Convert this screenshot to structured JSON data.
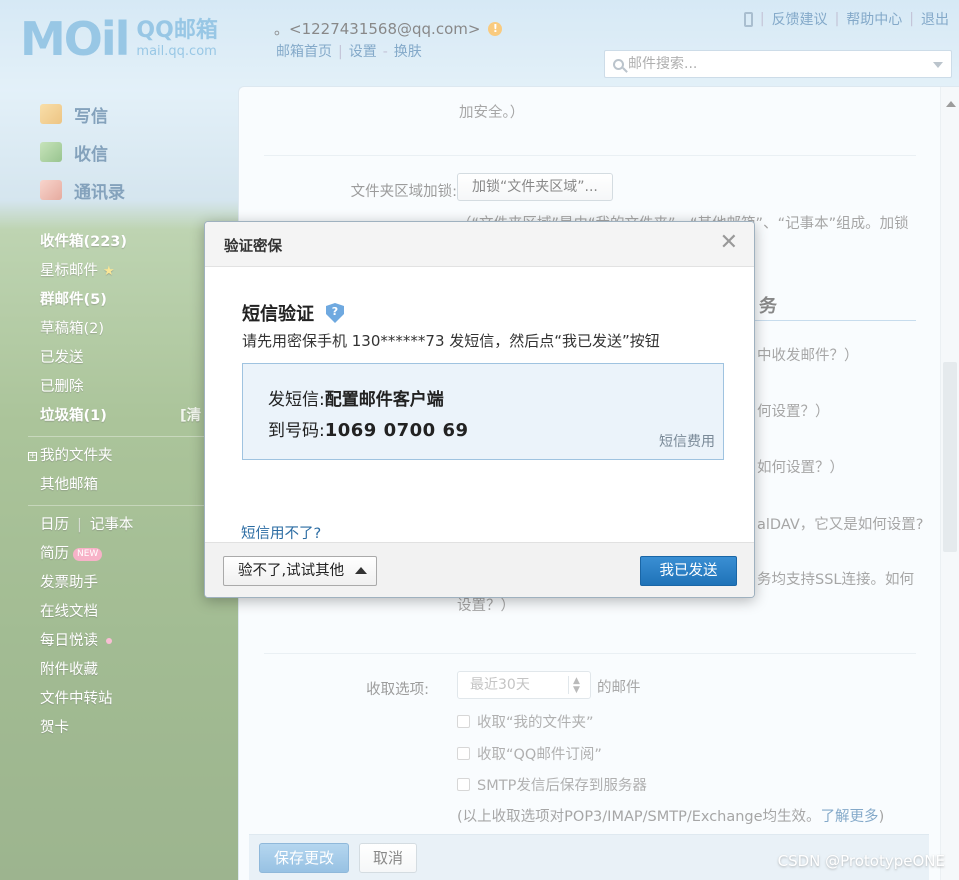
{
  "header": {
    "logo_mark": "MOil",
    "logo_title": "QQ邮箱",
    "logo_sub": "mail.qq.com",
    "account_prefix": "。",
    "account_email": "<1227431568@qq.com>",
    "links": [
      "邮箱首页",
      "设置",
      "换肤"
    ],
    "right_links": [
      "反馈建议",
      "帮助中心",
      "退出"
    ],
    "search_placeholder": "邮件搜索..."
  },
  "sidebar": {
    "actions": [
      "写信",
      "收信",
      "通讯录"
    ],
    "folders": {
      "inbox": "收件箱(223)",
      "starred": "星标邮件",
      "group": "群邮件(5)",
      "drafts": "草稿箱(2)",
      "sent": "已发送",
      "deleted": "已删除",
      "spam": "垃圾箱(1)",
      "spam_clear": "[清",
      "my_folders": "我的文件夹",
      "other_mail": "其他邮箱",
      "calendar": "日历",
      "notes": "记事本",
      "resume": "简历",
      "resume_badge": "NEW",
      "invoice": "发票助手",
      "docs": "在线文档",
      "reading": "每日悦读",
      "attachments": "附件收藏",
      "transfer": "文件中转站",
      "cards": "贺卡"
    }
  },
  "main": {
    "top_text": "加安全。）",
    "folder_lock_label": "文件夹区域加锁:",
    "folder_lock_button": "加锁“文件夹区域”...",
    "folder_lock_desc": "（“文件夹区域”是由“我的文件夹”、“其他邮箱”、“记事本”组成。加锁",
    "section_title_tail": "务",
    "hint1": "中收发邮件？）",
    "hint2": "何设置？）",
    "hint3": "如何设置？）",
    "hint4": "alDAV，它又是如何设置?",
    "hint5": "务均支持SSL连接。如何",
    "hint5b": "设置？）",
    "receive_label": "收取选项:",
    "receive_select": "最近30天",
    "receive_suffix": "的邮件",
    "checkbox1": "收取“我的文件夹”",
    "checkbox2": "收取“QQ邮件订阅”",
    "checkbox3": "SMTP发信后保存到服务器",
    "note": "(以上收取选项对POP3/IMAP/SMTP/Exchange均生效。",
    "note_link": "了解更多",
    "note_end": ")",
    "save": "保存更改",
    "cancel": "取消"
  },
  "watermark": "CSDN @PrototypeONE",
  "modal": {
    "title": "验证密保",
    "heading": "短信验证",
    "desc": "请先用密保手机 130******73 发短信，然后点“我已发送”按钮",
    "send_label": "发短信:",
    "send_content": "配置邮件客户端",
    "to_label": "到号码:",
    "to_number": "1069 0700 69",
    "fee_link": "短信费用",
    "help_link": "短信用不了?",
    "alt_button": "验不了,试试其他",
    "sent_button": "我已发送"
  }
}
